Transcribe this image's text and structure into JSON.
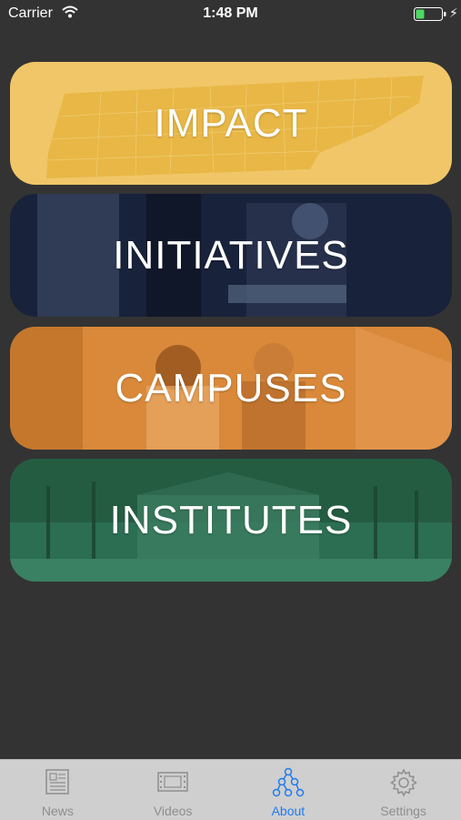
{
  "status_bar": {
    "carrier": "Carrier",
    "time": "1:48 PM"
  },
  "cards": {
    "impact": {
      "label": "IMPACT",
      "color": "#f0c668"
    },
    "initiatives": {
      "label": "INITIATIVES",
      "color": "#18223a"
    },
    "campuses": {
      "label": "CAMPUSES",
      "color": "#d98939"
    },
    "institutes": {
      "label": "INSTITUTES",
      "color": "#2c6e52"
    }
  },
  "tab_bar": {
    "active_color": "#1f7bf0",
    "inactive_color": "#8e8e8e",
    "tabs": [
      {
        "label": "News",
        "icon": "newspaper-icon"
      },
      {
        "label": "Videos",
        "icon": "film-icon"
      },
      {
        "label": "About",
        "icon": "network-icon"
      },
      {
        "label": "Settings",
        "icon": "gear-icon"
      }
    ]
  }
}
